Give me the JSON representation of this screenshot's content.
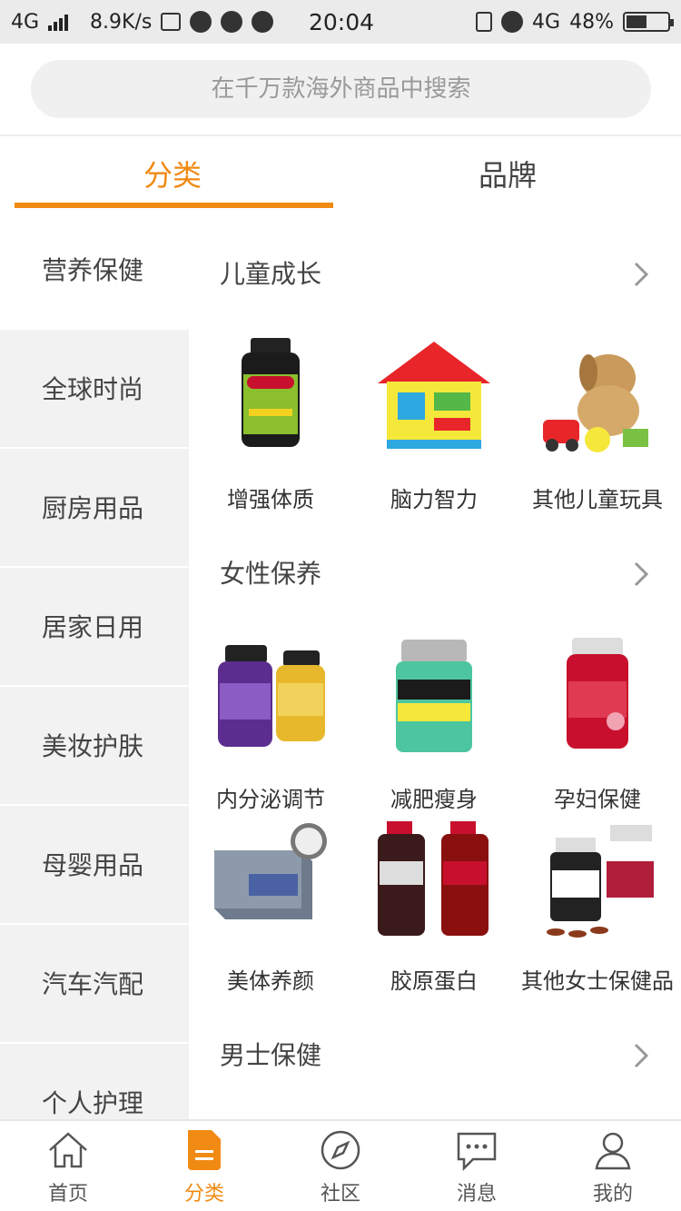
{
  "status_bar": {
    "network": "4G",
    "speed": "8.9K/s",
    "time": "20:04",
    "network_right": "4G",
    "battery": "48%"
  },
  "search": {
    "placeholder": "在千万款海外商品中搜索"
  },
  "tabs": [
    {
      "label": "分类"
    },
    {
      "label": "品牌"
    }
  ],
  "sidebar": {
    "items": [
      {
        "label": "营养保健"
      },
      {
        "label": "全球时尚"
      },
      {
        "label": "厨房用品"
      },
      {
        "label": "居家日用"
      },
      {
        "label": "美妆护肤"
      },
      {
        "label": "母婴用品"
      },
      {
        "label": "汽车汽配"
      },
      {
        "label": "个人护理"
      }
    ]
  },
  "sections": [
    {
      "title": "儿童成长",
      "products": [
        {
          "label": "增强体质"
        },
        {
          "label": "脑力智力"
        },
        {
          "label": "其他儿童玩具"
        }
      ]
    },
    {
      "title": "女性保养",
      "products": [
        {
          "label": "内分泌调节"
        },
        {
          "label": "减肥瘦身"
        },
        {
          "label": "孕妇保健"
        },
        {
          "label": "美体养颜"
        },
        {
          "label": "胶原蛋白"
        },
        {
          "label": "其他女士保健品"
        }
      ]
    },
    {
      "title": "男士保健",
      "products": []
    }
  ],
  "bottom_nav": [
    {
      "label": "首页",
      "icon": "home-icon"
    },
    {
      "label": "分类",
      "icon": "category-icon"
    },
    {
      "label": "社区",
      "icon": "compass-icon"
    },
    {
      "label": "消息",
      "icon": "message-icon"
    },
    {
      "label": "我的",
      "icon": "user-icon"
    }
  ],
  "colors": {
    "accent": "#f08a13",
    "sidebar_bg": "#f2f2f2"
  }
}
